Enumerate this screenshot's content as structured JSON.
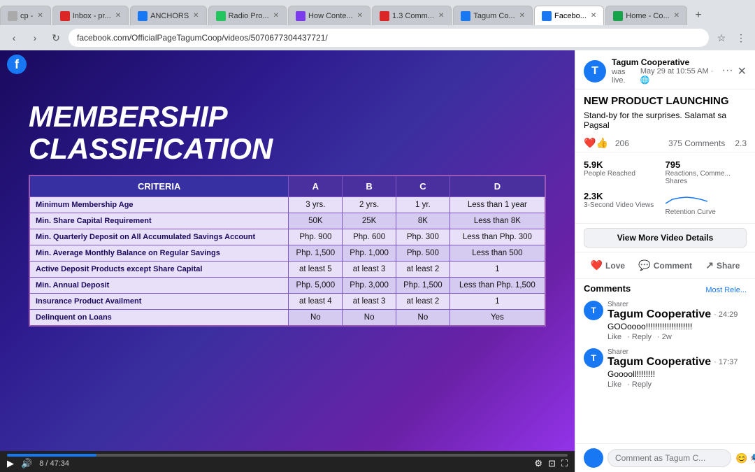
{
  "browser": {
    "url": "facebook.com/OfficialPageTagumCoop/videos/5070677304437721/",
    "tabs": [
      {
        "id": "tab-1",
        "label": "cp -",
        "favicon_color": "#aaa",
        "active": false
      },
      {
        "id": "tab-2",
        "label": "Inbox - pr...",
        "favicon_color": "#dc2626",
        "active": false
      },
      {
        "id": "tab-3",
        "label": "ANCHORS",
        "favicon_color": "#1877f2",
        "active": false
      },
      {
        "id": "tab-4",
        "label": "Radio Pro...",
        "favicon_color": "#22c55e",
        "active": false
      },
      {
        "id": "tab-5",
        "label": "How Conte...",
        "favicon_color": "#7c3aed",
        "active": false
      },
      {
        "id": "tab-6",
        "label": "1.3 Comm...",
        "favicon_color": "#dc2626",
        "active": false
      },
      {
        "id": "tab-7",
        "label": "Tagum Co...",
        "favicon_color": "#1877f2",
        "active": false
      },
      {
        "id": "tab-8",
        "label": "Facebo...",
        "favicon_color": "#1877f2",
        "active": true
      },
      {
        "id": "tab-9",
        "label": "Home - Co...",
        "favicon_color": "#16a34a",
        "active": false
      }
    ],
    "nav": {
      "back": "‹",
      "forward": "›",
      "reload": "↻"
    }
  },
  "slide": {
    "title_line1": "MEMBERSHIP",
    "title_line2": "CLASSIFICATION",
    "table": {
      "headers": [
        "CRITERIA",
        "A",
        "B",
        "C",
        "D"
      ],
      "rows": [
        {
          "criteria": "Minimum Membership Age",
          "a": "3 yrs.",
          "b": "2 yrs.",
          "c": "1 yr.",
          "d": "Less than 1 year"
        },
        {
          "criteria": "Min. Share Capital Requirement",
          "a": "50K",
          "b": "25K",
          "c": "8K",
          "d": "Less than 8K"
        },
        {
          "criteria": "Min. Quarterly Deposit on All Accumulated Savings Account",
          "a": "Php. 900",
          "b": "Php. 600",
          "c": "Php. 300",
          "d": "Less than Php. 300"
        },
        {
          "criteria": "Min. Average Monthly Balance on Regular Savings",
          "a": "Php. 1,500",
          "b": "Php. 1,000",
          "c": "Php. 500",
          "d": "Less than 500"
        },
        {
          "criteria": "Active Deposit Products except Share Capital",
          "a": "at least 5",
          "b": "at least 3",
          "c": "at least 2",
          "d": "1"
        },
        {
          "criteria": "Min. Annual Deposit",
          "a": "Php. 5,000",
          "b": "Php. 3,000",
          "c": "Php. 1,500",
          "d": "Less than Php. 1,500"
        },
        {
          "criteria": "Insurance Product Availment",
          "a": "at least 4",
          "b": "at least 3",
          "c": "at least 2",
          "d": "1"
        },
        {
          "criteria": "Delinquent on Loans",
          "a": "No",
          "b": "No",
          "c": "No",
          "d": "Yes"
        }
      ]
    }
  },
  "video": {
    "time_current": "8 / 47:34",
    "progress_percent": 16,
    "controls": {
      "play": "▶",
      "volume": "🔊",
      "settings": "⚙",
      "pip": "⊡",
      "fullscreen": "⛶"
    }
  },
  "sidebar": {
    "page_name": "Tagum Cooperative",
    "was_live": "was live.",
    "date": "May 29 at 10:55 AM · 🌐",
    "post_title": "NEW PRODUCT LAUNCHING",
    "post_desc": "Stand-by for the surprises. Salamat sa Pagsal",
    "reactions": {
      "heart_emoji": "❤️",
      "like_emoji": "👍",
      "count": "206",
      "comments_count": "375 Comments",
      "shares": "2.3"
    },
    "stats": {
      "reached_value": "5.9K",
      "reached_label": "People Reached",
      "reactions_value": "795",
      "reactions_label": "Reactions, Comme... Shares",
      "video_views_value": "2.3K",
      "video_views_label": "3-Second Video Views",
      "retention_label": "Retention Curve"
    },
    "view_more_btn": "View More Video Details",
    "actions": {
      "love": "Love",
      "comment": "Comment",
      "share": "Share"
    },
    "comments": {
      "title": "Comments",
      "filter": "Most Rele...",
      "items": [
        {
          "id": "comment-1",
          "sharer": "Sharer",
          "name": "Tagum Cooperative",
          "time": "· 24:29",
          "text": "GOOoooo!!!!!!!!!!!!!!!!!!!!",
          "actions": [
            "Like",
            "· Reply",
            "· 2w"
          ]
        },
        {
          "id": "comment-2",
          "sharer": "Sharer",
          "name": "Tagum Cooperative",
          "time": "· 17:37",
          "text": "Gooooll!!!!!!!!",
          "actions": [
            "Like",
            "· Reply"
          ]
        }
      ],
      "input_placeholder": "Comment as Tagum C...",
      "input_icons": [
        "🎭",
        "😊"
      ]
    }
  }
}
